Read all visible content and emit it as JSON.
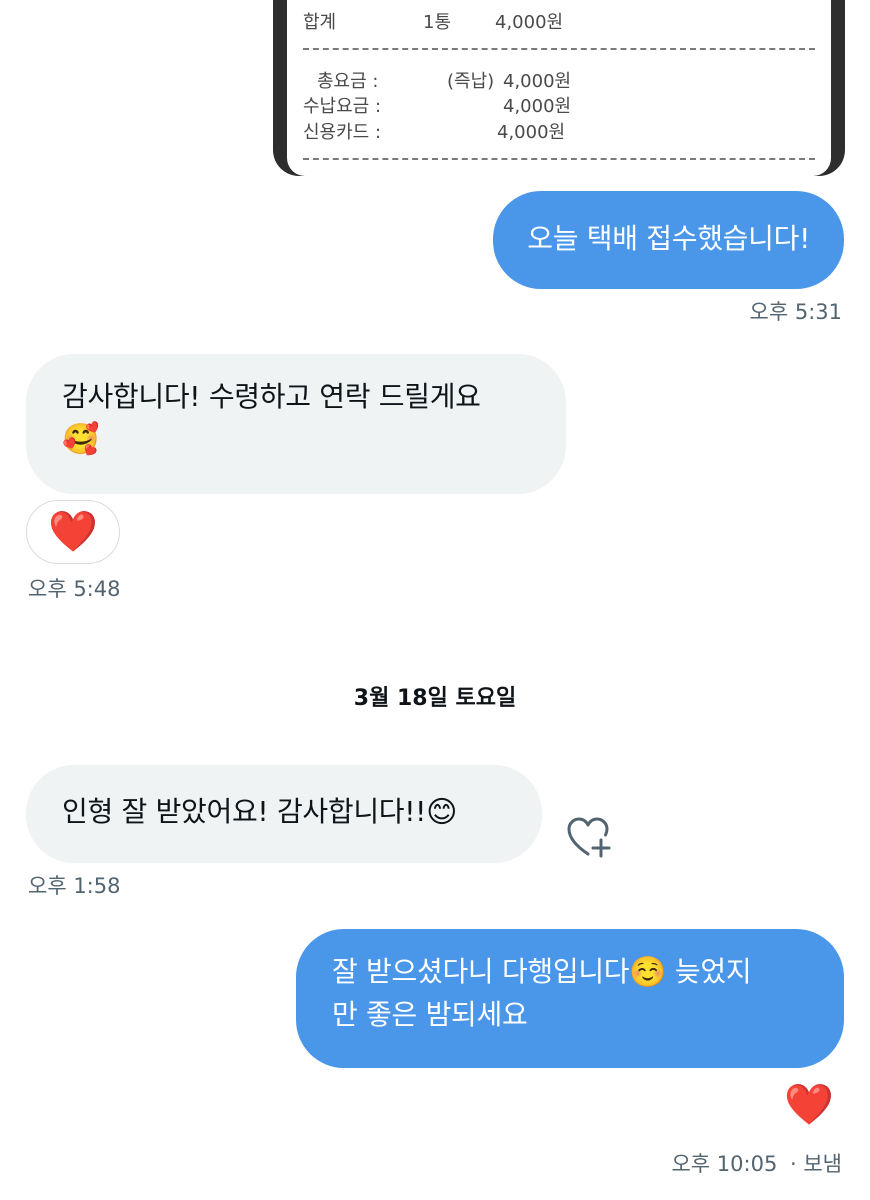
{
  "receipt": {
    "total_row": {
      "label": "합계",
      "count": "1통",
      "amount": "4,000원"
    },
    "rows": [
      {
        "label": "총요금 :",
        "note": "(즉납)",
        "amount": "4,000원"
      },
      {
        "label": "수납요금 :",
        "note": "",
        "amount": "4,000원"
      },
      {
        "label": "신용카드 :",
        "note": "",
        "amount": "4,000원"
      }
    ]
  },
  "messages": [
    {
      "direction": "out",
      "text": "오늘 택배 접수했습니다!",
      "time": "오후 5:31"
    },
    {
      "direction": "in",
      "text_line1": "감사합니다! 수령하고 연락 드릴게요",
      "emoji": "🥰",
      "reaction": "❤️",
      "time": "오후 5:48"
    }
  ],
  "date_separator": "3월 18일 토요일",
  "messages_day2": [
    {
      "direction": "in",
      "text": "인형 잘 받았어요! 감사합니다!!",
      "emoji": "😊",
      "time": "오후 1:58",
      "add_reaction_icon": "heart-plus-icon"
    },
    {
      "direction": "out",
      "text_line1_a": "잘 받으셨다니 다행입니다",
      "emoji": "☺️",
      "text_line1_b": " 늦었지",
      "text_line2": "만 좋은 밤되세요",
      "reaction": "❤️",
      "time": "오후 10:05",
      "status": "· 보냄"
    }
  ],
  "colors": {
    "outgoing_bubble": "#4a97ea",
    "incoming_bubble": "#eff3f4",
    "meta_text": "#536471",
    "heart": "#e0132b"
  }
}
